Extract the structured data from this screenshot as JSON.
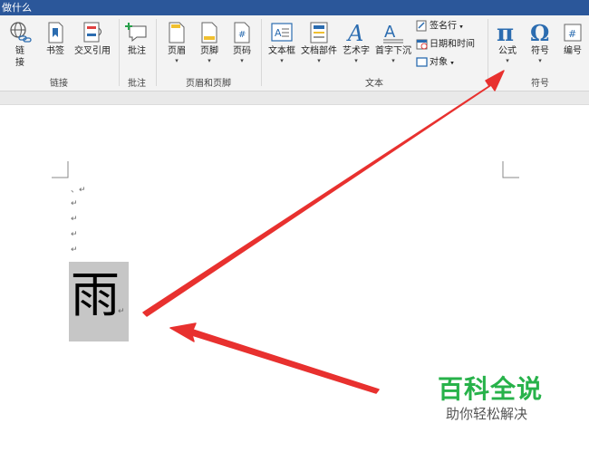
{
  "titlebar": {
    "search_text": "做什么"
  },
  "ribbon": {
    "groups": {
      "links": "链接",
      "comments": "批注",
      "header_footer": "页眉和页脚",
      "text": "文本",
      "symbols": "符号"
    },
    "buttons": {
      "link": "链\n接",
      "bookmark": "书签",
      "cross_ref": "交叉引用",
      "comment": "批注",
      "header": "页眉",
      "footer": "页脚",
      "page_number": "页码",
      "textbox": "文本框",
      "doc_parts": "文档部件",
      "wordart": "艺术字",
      "dropcap": "首字下沉",
      "signature_line": "签名行",
      "datetime": "日期和时间",
      "object": "对象",
      "equation": "公式",
      "symbol": "符号",
      "numbering": "编号"
    }
  },
  "document": {
    "first_mark": "、↵",
    "para_mark": "↵",
    "rain_char": "雨"
  },
  "watermark": {
    "title": "百科全说",
    "subtitle": "助你轻松解决"
  },
  "colors": {
    "arrow": "#e8312f",
    "title_bar": "#2b579a",
    "watermark_green": "#27b24a"
  }
}
